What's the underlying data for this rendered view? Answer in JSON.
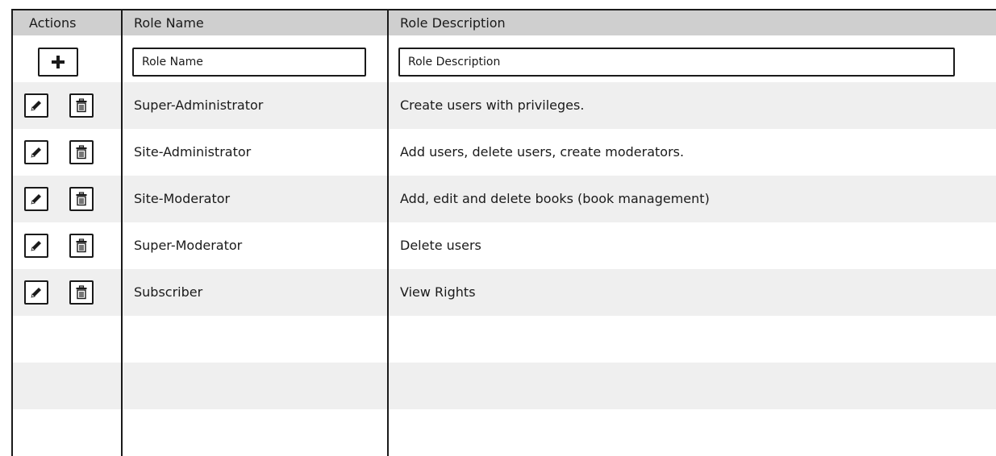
{
  "table": {
    "headers": {
      "actions": "Actions",
      "role_name": "Role Name",
      "role_description": "Role Description"
    },
    "new_row": {
      "role_name_placeholder": "Role Name",
      "role_description_placeholder": "Role Description",
      "add_icon": "plus-icon"
    },
    "rows": [
      {
        "name": "Super-Administrator",
        "description": "Create users with privileges."
      },
      {
        "name": "Site-Administrator",
        "description": "Add users, delete users, create moderators."
      },
      {
        "name": "Site-Moderator",
        "description": "Add, edit and delete books (book management)"
      },
      {
        "name": "Super-Moderator",
        "description": "Delete users"
      },
      {
        "name": "Subscriber",
        "description": "View Rights"
      }
    ],
    "row_icons": {
      "edit": "pencil-icon",
      "delete": "trash-icon"
    },
    "colors": {
      "header_bg": "#cfcfcf",
      "stripe_bg": "#efefef",
      "border": "#1a1a1a"
    }
  }
}
